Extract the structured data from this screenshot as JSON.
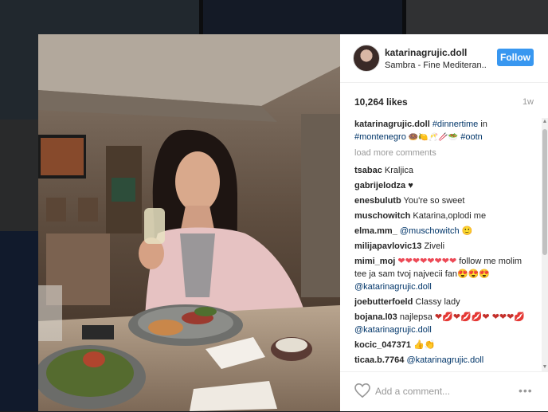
{
  "post": {
    "username": "katarinagrujic.doll",
    "location": "Sambra - Fine Mediteran..",
    "follow_label": "Follow",
    "likes": "10,264 likes",
    "age": "1w",
    "caption_user": "katarinagrujic.doll",
    "caption_tag1": "#dinnertime",
    "caption_in": "in",
    "caption_tag2": "#montenegro",
    "caption_emojis": "🍩🍋🥂🥢🥗",
    "caption_tag3": "#ootn",
    "load_more": "load more comments",
    "add_comment_placeholder": "Add a comment...",
    "more_label": "•••"
  },
  "comments": [
    {
      "user": "tsabac",
      "text": "Kraljica"
    },
    {
      "user": "gabrijelodza",
      "text": "♥"
    },
    {
      "user": "enesbulutb",
      "text": "You're so sweet"
    },
    {
      "user": "muschowitch",
      "text": "Katarina,oplodi me"
    },
    {
      "user": "elma.mm_",
      "mention": "@muschowitch",
      "text": "🙂"
    },
    {
      "user": "milijapavlovic13",
      "text": "Ziveli"
    },
    {
      "user": "mimi_moj",
      "hearts": "❤❤❤❤❤❤❤❤",
      "text": "follow me molim tee ja sam tvoj najvecii fan😍😍😍",
      "mention": "@katarinagrujic.doll"
    },
    {
      "user": "joebutterfoeld",
      "text": "Classy lady"
    },
    {
      "user": "bojana.l03",
      "text": "najlepsa",
      "emojis": "❤💋❤💋💋❤ ❤❤❤💋",
      "mention": "@katarinagrujic.doll"
    },
    {
      "user": "kocic_047371",
      "text": "👍👏"
    },
    {
      "user": "ticaa.b.7764",
      "mention": "@katarinagrujic.doll"
    }
  ],
  "colors": {
    "follow_blue": "#3897f0",
    "link": "#003569",
    "muted": "#999999",
    "text": "#262626"
  },
  "icons": {
    "like": "heart-outline-icon",
    "more": "ellipsis-icon",
    "scroll_up": "scroll-up-arrow-icon",
    "scroll_down": "scroll-down-arrow-icon"
  }
}
